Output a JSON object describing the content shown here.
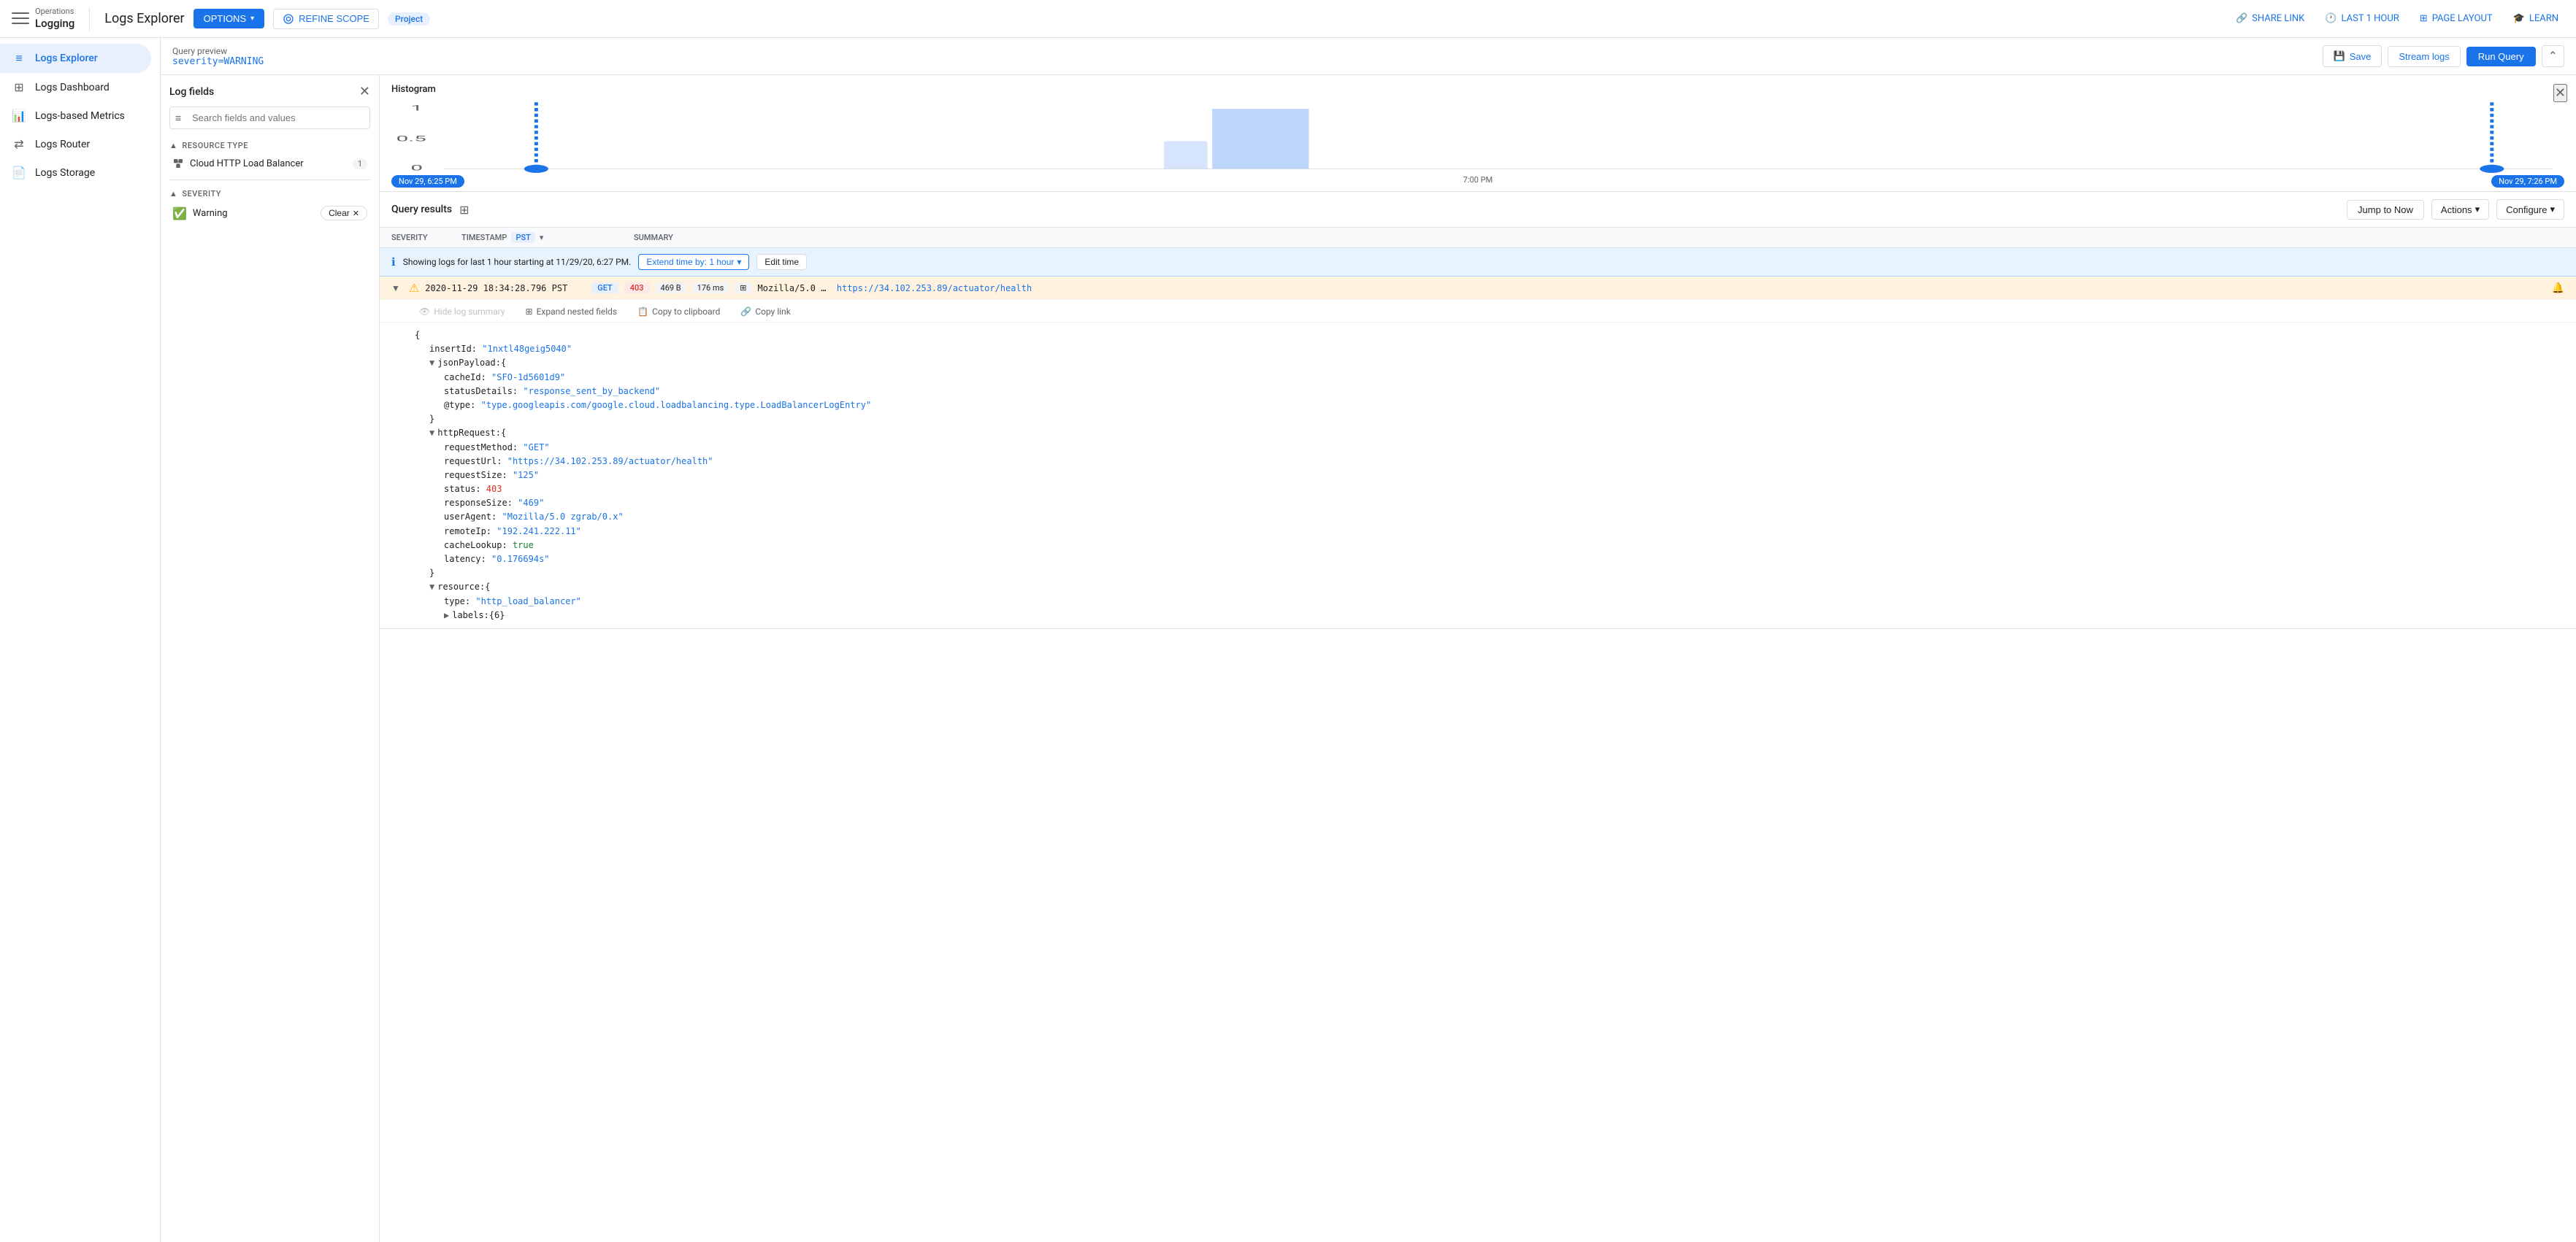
{
  "app": {
    "title": "Operations\nLogging"
  },
  "topnav": {
    "page_title": "Logs Explorer",
    "options_label": "OPTIONS",
    "refine_scope_label": "REFINE SCOPE",
    "refine_scope_badge": "Project",
    "share_link": "SHARE LINK",
    "last_1_hour": "LAST 1 HOUR",
    "page_layout": "PAGE LAYOUT",
    "learn": "LEARN"
  },
  "querybar": {
    "preview_label": "Query preview",
    "query_value": "severity=WARNING",
    "save_label": "Save",
    "stream_label": "Stream logs",
    "run_label": "Run Query"
  },
  "log_fields": {
    "title": "Log fields",
    "search_placeholder": "Search fields and values",
    "resource_type_label": "RESOURCE TYPE",
    "resource_item": "Cloud HTTP Load Balancer",
    "resource_count": "1",
    "severity_label": "SEVERITY",
    "warning_label": "Warning",
    "clear_label": "Clear"
  },
  "histogram": {
    "title": "Histogram",
    "time_left": "Nov 29, 6:25 PM",
    "time_middle": "7:00 PM",
    "time_right": "Nov 29, 7:26 PM"
  },
  "query_results": {
    "title": "Query results",
    "jump_to_now": "Jump to Now",
    "actions_label": "Actions",
    "configure_label": "Configure",
    "severity_col": "SEVERITY",
    "timestamp_col": "TIMESTAMP",
    "pst_label": "PST",
    "summary_col": "SUMMARY",
    "info_text": "Showing logs for last 1 hour starting at 11/29/20, 6:27 PM.",
    "extend_label": "Extend time by: 1 hour",
    "edit_time_label": "Edit time"
  },
  "log_entry": {
    "timestamp": "2020-11-29 18:34:28.796 PST",
    "method": "GET",
    "status": "403",
    "size": "469 B",
    "latency": "176 ms",
    "user_agent": "Mozilla/5.0 …",
    "url": "https://34.102.253.89/actuator/health"
  },
  "log_detail": {
    "hide_summary_label": "Hide log summary",
    "expand_nested_label": "Expand nested fields",
    "copy_clipboard_label": "Copy to clipboard",
    "copy_link_label": "Copy link",
    "insert_id": "1nxtl48geig5040",
    "json_payload_cacheId": "SFO-1d5601d9",
    "json_payload_statusDetails": "response_sent_by_backend",
    "json_payload_type": "type.googleapis.com/google.cloud.loadbalancing.type.LoadBalancerLogEntry",
    "http_method": "GET",
    "http_url": "https://34.102.253.89/actuator/health",
    "http_size": "125",
    "http_status": "403",
    "http_responseSize": "469",
    "http_userAgent": "Mozilla/5.0 zgrab/0.x",
    "http_remoteIp": "192.241.222.11",
    "http_cacheLookup": "true",
    "http_latency": "0.176694s",
    "resource_type": "http_load_balancer",
    "resource_labels": "6"
  }
}
